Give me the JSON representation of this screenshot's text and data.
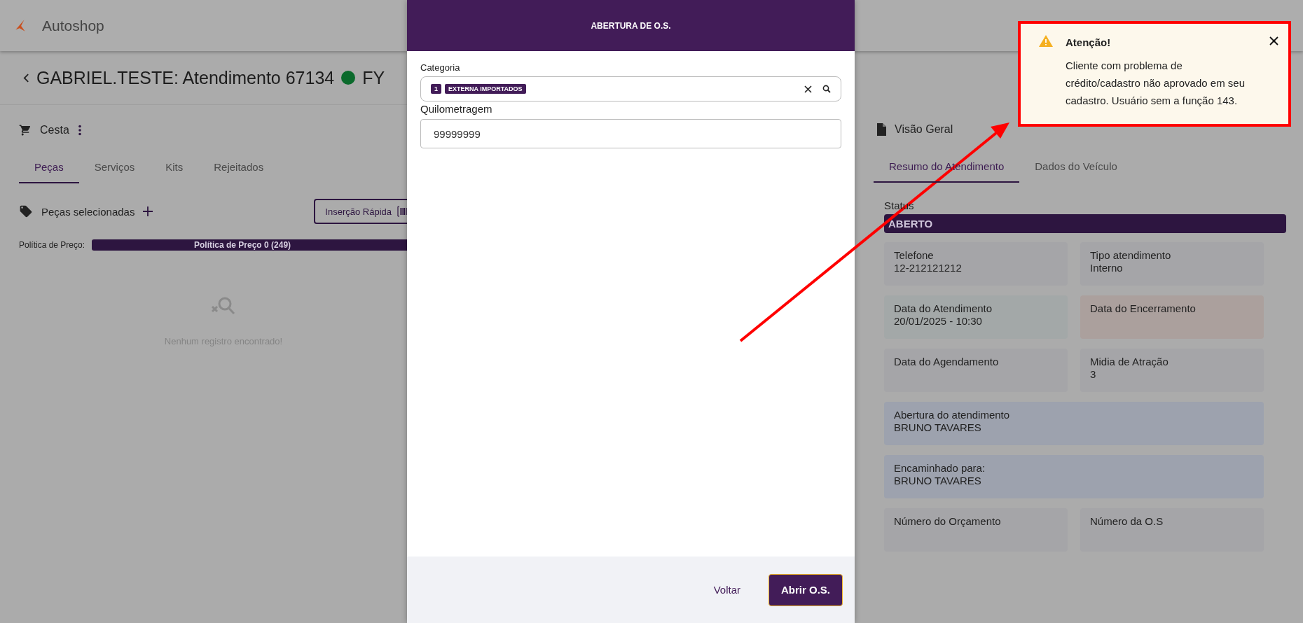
{
  "app": {
    "name": "Autoshop"
  },
  "page": {
    "title": "GABRIEL.TESTE: Atendimento 67134",
    "title_tail": "FY"
  },
  "basket": {
    "title": "Cesta",
    "tabs": [
      {
        "label": "Peças",
        "selected": true
      },
      {
        "label": "Serviços",
        "selected": false
      },
      {
        "label": "Kits",
        "selected": false
      },
      {
        "label": "Rejeitados",
        "selected": false
      }
    ],
    "selected_parts_label": "Peças selecionadas",
    "quick_insert": "Inserção Rápida",
    "price_policy_label": "Política de Preço:",
    "price_policy_value": "Política de Preço 0 (249)",
    "empty_message": "Nenhum registro encontrado!"
  },
  "dialog": {
    "title": "ABERTURA DE O.S.",
    "category": {
      "label": "Categoria",
      "chips": [
        "1",
        "EXTERNA IMPORTADOS"
      ]
    },
    "mileage": {
      "label": "Quilometragem",
      "value": "99999999"
    },
    "buttons": [
      {
        "label": "Voltar",
        "kind": "text"
      },
      {
        "label": "Abrir O.S.",
        "kind": "primary"
      }
    ]
  },
  "overview": {
    "title": "Visão Geral",
    "tabs": [
      {
        "label": "Resumo do Atendimento",
        "selected": true
      },
      {
        "label": "Dados do Veículo",
        "selected": false
      }
    ],
    "status_label": "Status",
    "status_value": "ABERTO",
    "cards": [
      {
        "label": "Telefone",
        "value": "12-212121212",
        "color": "#a5a5a8",
        "wide": false
      },
      {
        "label": "Tipo atendimento",
        "value": "Interno",
        "color": "#a5a5a8",
        "wide": false
      },
      {
        "label": "Data do Atendimento",
        "value": "20/01/2025 - 10:30",
        "color": "#a3a8a8",
        "wide": false
      },
      {
        "label": "Data do Encerramento",
        "color": "#aba09d",
        "wide": false
      },
      {
        "label": "Data do Agendamento",
        "color": "#a5a5a8",
        "wide": false
      },
      {
        "label": "Midia de Atração",
        "value": "3",
        "color": "#a5a5a8",
        "wide": false
      },
      {
        "label": "Abertura do atendimento",
        "value": "BRUNO TAVARES",
        "color": "#9da2ae",
        "wide": true
      },
      {
        "label": "Encaminhado para:",
        "value": "BRUNO TAVARES",
        "color": "#9da2ae",
        "wide": true
      },
      {
        "label": "Número do Orçamento",
        "color": "#a5a5a8",
        "wide": false
      },
      {
        "label": "Número da O.S",
        "color": "#a5a5a8",
        "wide": false
      }
    ]
  },
  "toast": {
    "title": "Atenção!",
    "message": "Cliente com problema de crédito/cadastro não aprovado em seu cadastro. Usuário sem a função 143."
  }
}
